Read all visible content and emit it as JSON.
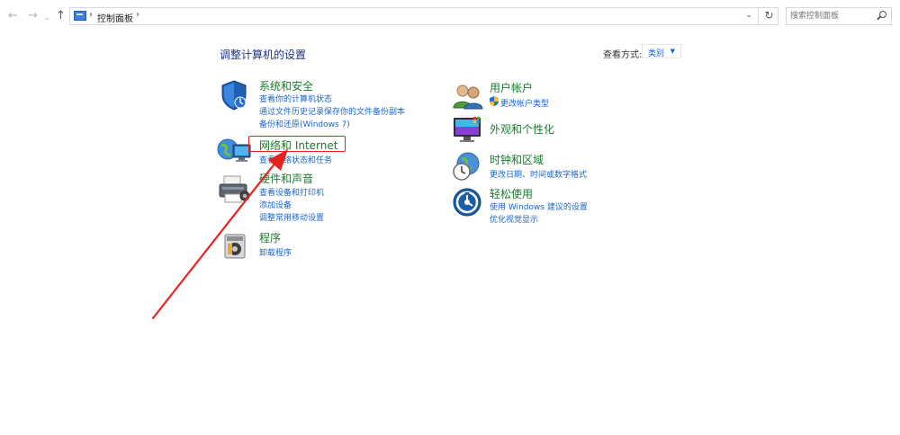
{
  "address_bar": {
    "crumb": "控制面板",
    "refresh_glyph": "↻",
    "dropdown_glyph": "⌄",
    "back_glyph": "←",
    "forward_glyph": "→",
    "up_glyph": "↑",
    "sep_glyph": "›"
  },
  "search": {
    "placeholder": "搜索控制面板"
  },
  "header": {
    "title": "调整计算机的设置",
    "view_by_label": "查看方式:",
    "view_by_value": "类别",
    "view_by_caret": "▼"
  },
  "categories": {
    "system": {
      "title": "系统和安全",
      "links": [
        "查看你的计算机状态",
        "通过文件历史记录保存你的文件备份副本",
        "备份和还原(Windows 7)"
      ]
    },
    "network": {
      "title": "网络和 Internet",
      "links": [
        "查看网络状态和任务"
      ]
    },
    "hardware": {
      "title": "硬件和声音",
      "links": [
        "查看设备和打印机",
        "添加设备",
        "调整常用移动设置"
      ]
    },
    "programs": {
      "title": "程序",
      "links": [
        "卸载程序"
      ]
    },
    "user_accounts": {
      "title": "用户帐户",
      "links": [
        "更改帐户类型"
      ]
    },
    "appearance": {
      "title": "外观和个性化",
      "links": []
    },
    "clock": {
      "title": "时钟和区域",
      "links": [
        "更改日期、时间或数字格式"
      ]
    },
    "ease": {
      "title": "轻松使用",
      "links": [
        "使用 Windows 建议的设置",
        "优化视觉显示"
      ]
    }
  },
  "colors": {
    "category_title": "#1c7a30",
    "link": "#1a66cc",
    "annotation": "#e8231f"
  }
}
